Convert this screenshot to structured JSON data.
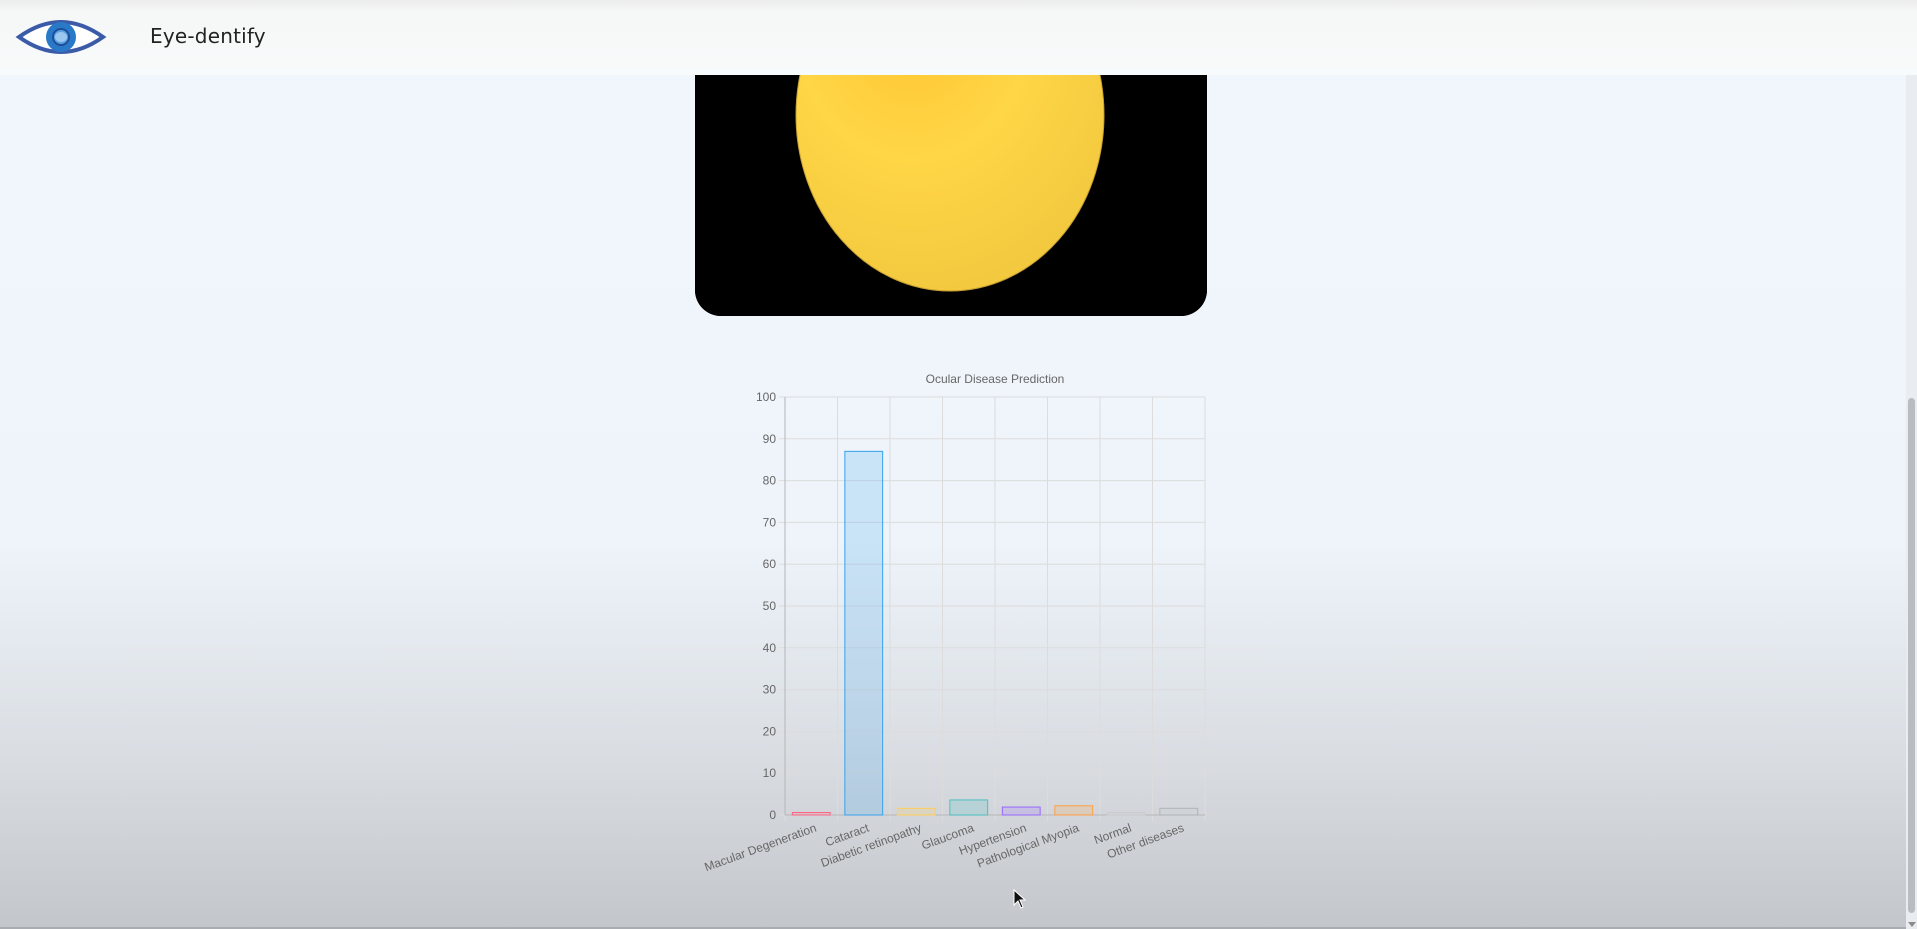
{
  "app": {
    "brand": "Eye-dentify",
    "logo_icon": "eye-icon",
    "accent_color": "#3b5aa8"
  },
  "result_image": {
    "description_icon": "fundus-image",
    "fundus_color": "#ffd646"
  },
  "chart_data": {
    "type": "bar",
    "title": "Ocular Disease Prediction",
    "categories": [
      "Macular Degeneration",
      "Cataract",
      "Diabetic retinopathy",
      "Glaucoma",
      "Hypertension",
      "Pathological Myopia",
      "Normal",
      "Other diseases"
    ],
    "values": [
      0.6,
      87,
      1.6,
      3.6,
      1.9,
      2.2,
      0.6,
      1.6
    ],
    "ylim": [
      0,
      100
    ],
    "yticks": [
      0,
      10,
      20,
      30,
      40,
      50,
      60,
      70,
      80,
      90,
      100
    ],
    "grid": true,
    "colors": [
      {
        "fill": "rgba(255,99,132,0.2)",
        "stroke": "#ff6384"
      },
      {
        "fill": "rgba(54,162,235,0.2)",
        "stroke": "#36a2eb"
      },
      {
        "fill": "rgba(255,206,86,0.2)",
        "stroke": "#ffce56"
      },
      {
        "fill": "rgba(75,192,192,0.2)",
        "stroke": "#4bc0c0"
      },
      {
        "fill": "rgba(153,102,255,0.2)",
        "stroke": "#9966ff"
      },
      {
        "fill": "rgba(255,159,64,0.2)",
        "stroke": "#ff9f40"
      },
      {
        "fill": "rgba(201,203,207,0.2)",
        "stroke": "#c9cbcf"
      },
      {
        "fill": "rgba(201,203,207,0.2)",
        "stroke": "#b0b3b8"
      }
    ]
  }
}
